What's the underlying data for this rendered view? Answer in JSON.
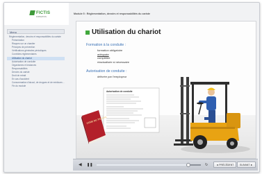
{
  "brand": {
    "name": "FICTIS",
    "tagline": "FORMATION"
  },
  "module": {
    "title": "Module 5 : Réglementation, devoirs et responsabilités du cariste"
  },
  "sidebar": {
    "menu_label": "Menu",
    "items": [
      {
        "label": "Réglementation, devoirs et responsabilités du cariste",
        "level": "top"
      },
      {
        "label": "Présentation",
        "level": "sub"
      },
      {
        "label": "Risques sur un chantier",
        "level": "sub"
      },
      {
        "label": "Principes de prévention",
        "level": "sub"
      },
      {
        "label": "Vérifications générales périodiques",
        "level": "sub"
      },
      {
        "label": "Contrôles réglementaires",
        "level": "sub"
      },
      {
        "label": "Utilisation du chariot",
        "level": "sub",
        "active": true
      },
      {
        "label": "Autorisation de conduite",
        "level": "sub"
      },
      {
        "label": "Organismes et instances",
        "level": "sub"
      },
      {
        "label": "Responsabilités",
        "level": "sub"
      },
      {
        "label": "Devoirs du cariste",
        "level": "sub"
      },
      {
        "label": "Droit de retrait",
        "level": "sub"
      },
      {
        "label": "En cas d'accident",
        "level": "sub"
      },
      {
        "label": "Consommation d'alcool, de drogues et de médicaments",
        "level": "sub"
      },
      {
        "label": "Fin du module",
        "level": "sub"
      }
    ]
  },
  "slide": {
    "title": "Utilisation du chariot",
    "formation": {
      "heading": "Formation à la conduite :",
      "bullets": [
        "formation obligatoire",
        "adéquate",
        "complétée",
        "réactualisée si nécessaire"
      ]
    },
    "autorisation": {
      "heading": "Autorisation de conduite :",
      "bullets": [
        "délivrée par l'employeur"
      ]
    },
    "document": {
      "title": "Autorisation de conduite"
    },
    "book": {
      "title": "CODE DU TRAVAIL"
    }
  },
  "controls": {
    "previous_label": "◄ PRÉCÉDENT",
    "next_label": "SUIVANT ►",
    "progress": 0.88
  },
  "colors": {
    "accent_green": "#41a83c",
    "heading_blue": "#3c73b6",
    "book_red": "#b3202a",
    "forklift_orange": "#e8a313"
  }
}
